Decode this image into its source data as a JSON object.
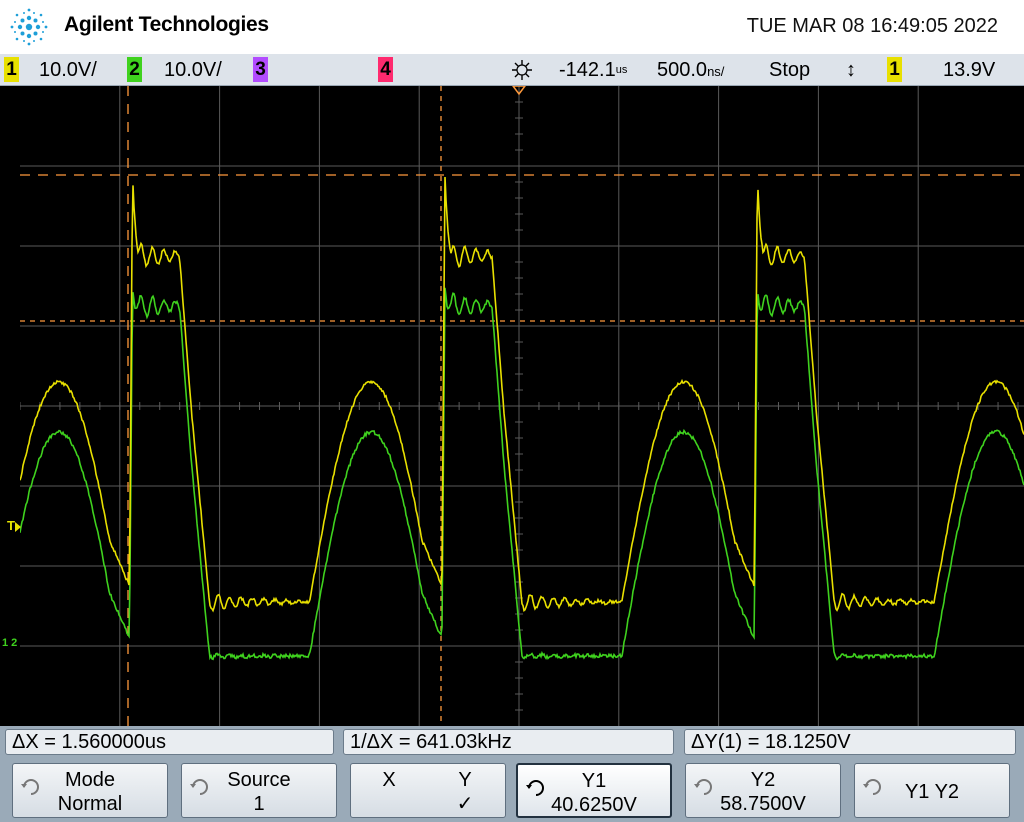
{
  "header": {
    "brand": "Agilent Technologies",
    "datetime": "TUE MAR 08 16:49:05 2022"
  },
  "statusbar": {
    "ch1_num": "1",
    "ch1_scale": "10.0V/",
    "ch2_num": "2",
    "ch2_scale": "10.0V/",
    "ch3_num": "3",
    "ch4_num": "4",
    "time_offset": "-142.1",
    "time_offset_unit": "us",
    "time_scale": "500.0",
    "time_scale_unit": "ns/",
    "run_state": "Stop",
    "trig_slope": "↕",
    "trig_source": "1",
    "trig_level": "13.9V"
  },
  "markers": {
    "trigger": "T",
    "ground": "1 2"
  },
  "measurements": {
    "delta_x": "ΔX = 1.560000us",
    "inv_delta_x": "1/ΔX = 641.03kHz",
    "delta_y": "ΔY(1) = 18.1250V"
  },
  "softkeys": {
    "mode_label": "Mode",
    "mode_value": "Normal",
    "source_label": "Source",
    "source_value": "1",
    "x_label": "X",
    "y_label": "Y",
    "y_check": "✓",
    "y1_label": "Y1",
    "y1_value": "40.6250V",
    "y2_label": "Y2",
    "y2_value": "58.7500V",
    "y1y2_label": "Y1 Y2"
  },
  "colors": {
    "ch1": "#e8e000",
    "ch2": "#3fd21e",
    "ch3": "#b24cff",
    "ch4": "#ff2a6e",
    "cursor": "#ff9a3c",
    "grid": "#5a5a5a"
  }
}
